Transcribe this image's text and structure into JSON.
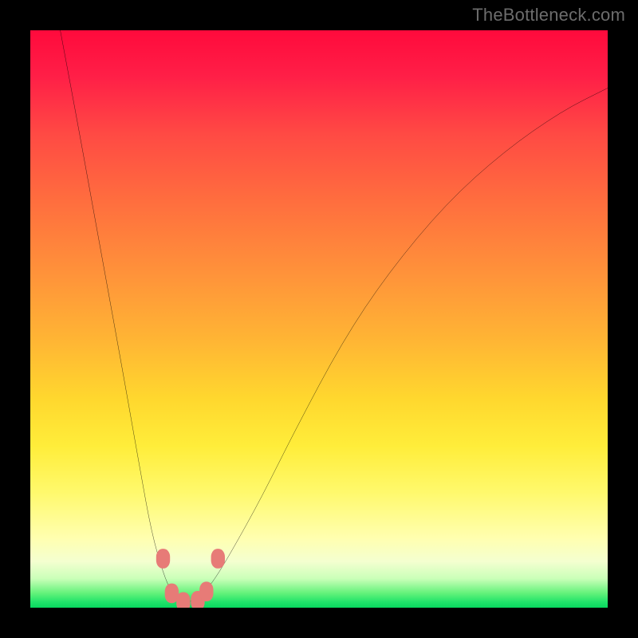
{
  "watermark": "TheBottleneck.com",
  "chart_data": {
    "type": "line",
    "title": "",
    "subtitle": "",
    "xlabel": "",
    "ylabel": "",
    "xlim": [
      0,
      100
    ],
    "ylim": [
      0,
      100
    ],
    "grid": false,
    "legend": null,
    "annotations_note": "No axis tick labels or data labels are visible; values below are estimated from pixel positions relative to the plot rectangle, normalized to 0–100 on each axis.",
    "series": [
      {
        "name": "curve",
        "stroke": "#000000",
        "x": [
          5,
          8,
          12,
          16,
          19,
          21,
          23,
          24.5,
          26,
          28,
          30,
          32,
          35,
          40,
          46,
          54,
          62,
          72,
          82,
          92,
          100
        ],
        "y": [
          101,
          85,
          63,
          41,
          24,
          13,
          6,
          2.5,
          1,
          1,
          2.5,
          5,
          10,
          19,
          31,
          46,
          58,
          70,
          79,
          86,
          90
        ]
      }
    ],
    "markers": [
      {
        "name": "pink-marker-left-upper",
        "x": 23.0,
        "y": 8.5,
        "color": "#e77b77"
      },
      {
        "name": "pink-marker-left-lower",
        "x": 24.5,
        "y": 2.5,
        "color": "#e77b77"
      },
      {
        "name": "pink-marker-bottom-left",
        "x": 26.5,
        "y": 1.0,
        "color": "#e77b77"
      },
      {
        "name": "pink-marker-bottom-right",
        "x": 29.0,
        "y": 1.2,
        "color": "#e77b77"
      },
      {
        "name": "pink-marker-right-lower",
        "x": 30.5,
        "y": 2.8,
        "color": "#e77b77"
      },
      {
        "name": "pink-marker-right-upper",
        "x": 32.5,
        "y": 8.5,
        "color": "#e77b77"
      }
    ],
    "colors": {
      "background_top": "#ff0a3c",
      "background_bottom": "#08d85f",
      "curve": "#000000",
      "marker": "#e77b77",
      "frame": "#000000",
      "watermark": "#6c6c6c"
    }
  }
}
